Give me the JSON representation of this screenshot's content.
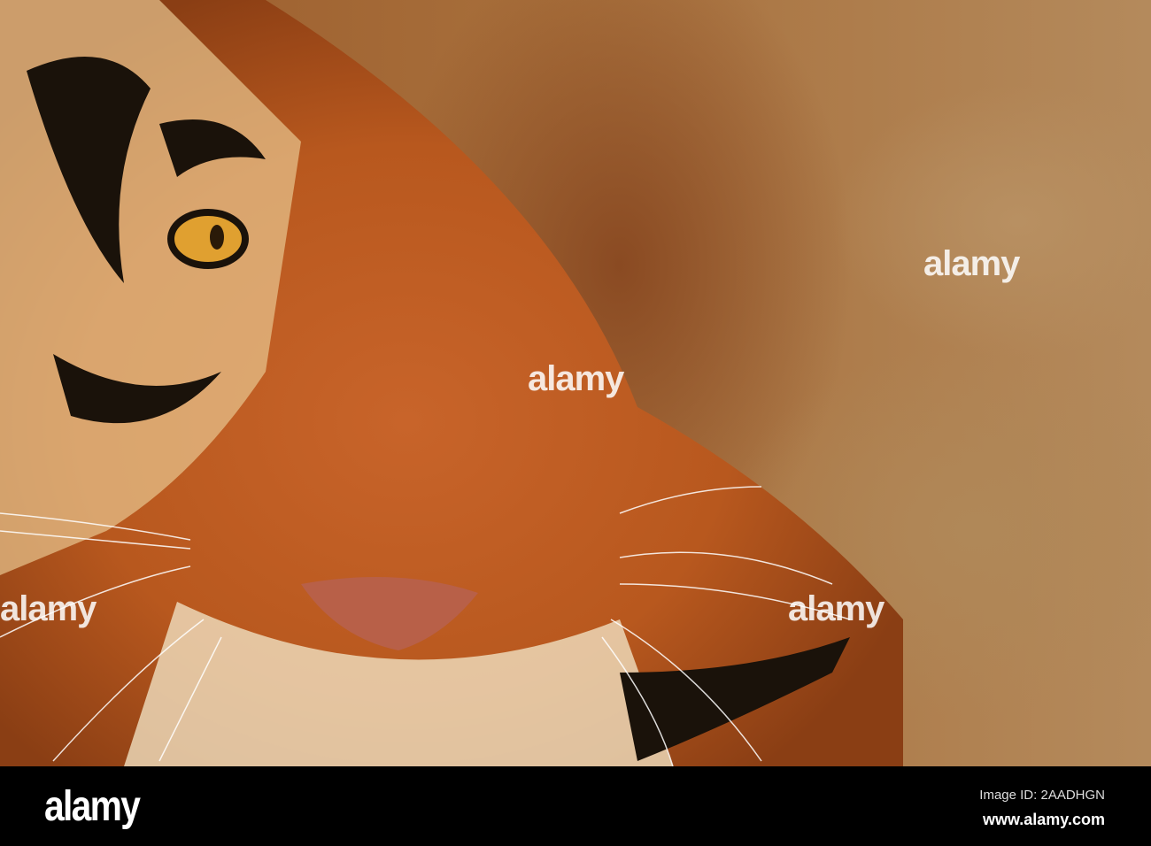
{
  "photo": {
    "subject": "tiger-face-closeup",
    "watermarks": [
      "alamy",
      "alamy",
      "alamy",
      "alamy"
    ]
  },
  "footer": {
    "logo": "alamy",
    "image_id": "Image ID: 2AADHGN",
    "url": "www.alamy.com"
  }
}
